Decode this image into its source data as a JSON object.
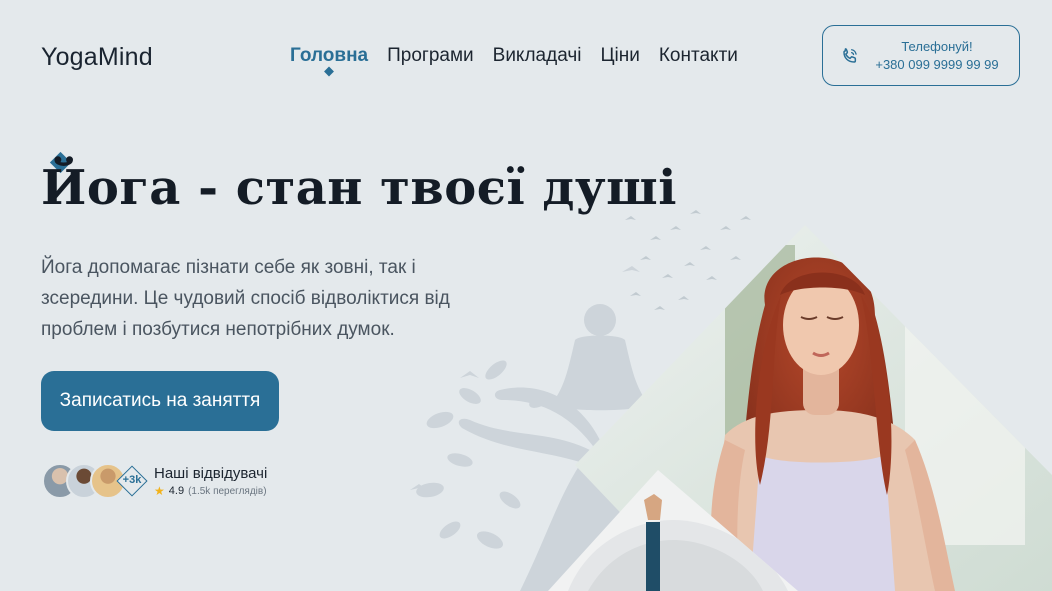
{
  "header": {
    "logo": "YogaMind",
    "nav": [
      {
        "label": "Головна",
        "active": true
      },
      {
        "label": "Програми",
        "active": false
      },
      {
        "label": "Викладачі",
        "active": false
      },
      {
        "label": "Ціни",
        "active": false
      },
      {
        "label": "Контакти",
        "active": false
      }
    ],
    "phone": {
      "label": "Телефонуй!",
      "number": "+380 099 9999 99 99",
      "icon": "phone-icon"
    }
  },
  "hero": {
    "title": "Йога - стан твоєї душі",
    "text": "Йога допомагає пізнати себе як зовні, так і зсередини. Це чудовий спосіб відволіктися від проблем і позбутися непотрібних думок.",
    "cta_label": "Записатись на заняття"
  },
  "visitors": {
    "count_badge": "+3k",
    "title": "Наші відвідувачі",
    "rating": "4.9",
    "views": "(1.5k переглядів)",
    "star_icon": "star-icon"
  },
  "colors": {
    "accent": "#2a6f96",
    "background": "#e4e9ec",
    "text": "#1c2530"
  }
}
